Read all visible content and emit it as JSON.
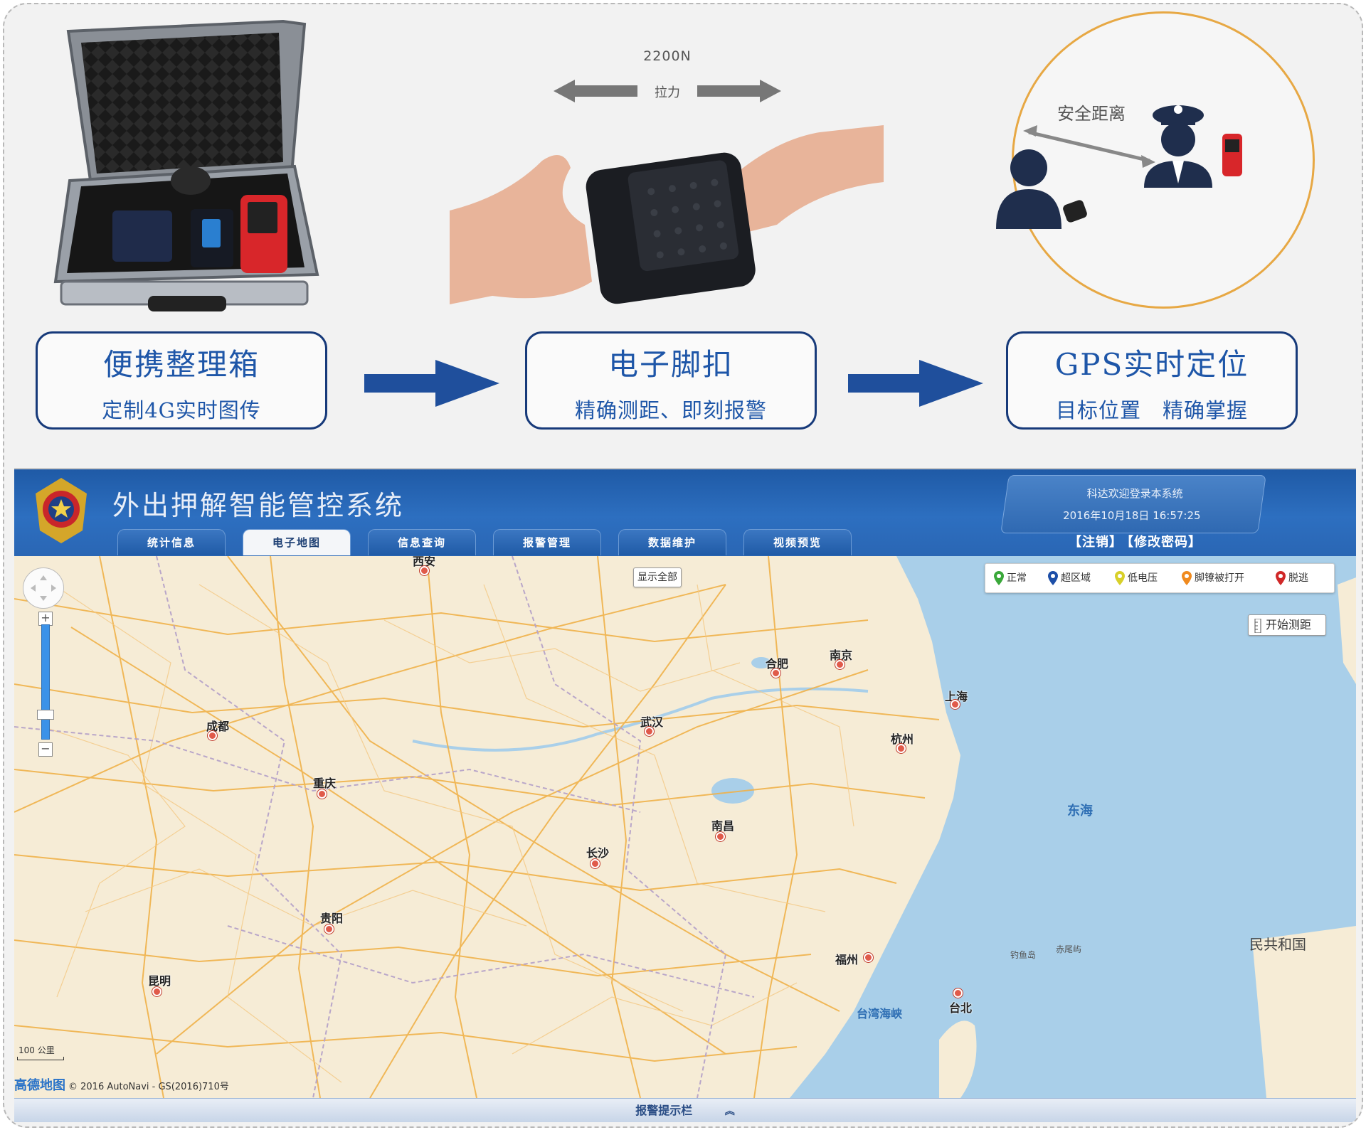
{
  "promo": {
    "force_value": "2200N",
    "force_label": "拉力",
    "safe_distance": "安全距离",
    "cards": [
      {
        "title": "便携整理箱",
        "subtitle": "定制4G实时图传"
      },
      {
        "title": "电子脚扣",
        "subtitle": "精确测距、即刻报警"
      },
      {
        "title": "GPS实时定位",
        "subtitle": "目标位置　精确掌握"
      }
    ]
  },
  "app": {
    "title": "外出押解智能管控系统",
    "welcome": "科达欢迎登录本系统",
    "datetime": "2016年10月18日 16:57:25",
    "logout_link": "【注销】",
    "change_password_link": "【修改密码】",
    "tabs": [
      {
        "label": "统计信息"
      },
      {
        "label": "电子地图"
      },
      {
        "label": "信息查询"
      },
      {
        "label": "报警管理"
      },
      {
        "label": "数据维护"
      },
      {
        "label": "视频预览"
      }
    ],
    "active_tab": "电子地图",
    "status_bar": "报警提示栏",
    "colors": {
      "header": "#2a66b4",
      "card_border": "#173a7a",
      "card_text": "#1e56a8",
      "arrow": "#1f4f9c",
      "gps_ring": "#e7a844"
    }
  },
  "map": {
    "show_all": "显示全部",
    "measure": "开始测距",
    "scale": "100 公里",
    "copyright_brand": "高德地图",
    "copyright": "© 2016 AutoNavi - GS(2016)710号",
    "legend": [
      {
        "label": "正常",
        "color": "#3aa83a"
      },
      {
        "label": "超区域",
        "color": "#1d4fa8"
      },
      {
        "label": "低电压",
        "color": "#d8d02a"
      },
      {
        "label": "脚镣被打开",
        "color": "#f08a1e"
      },
      {
        "label": "脱逃",
        "color": "#d02828"
      }
    ],
    "cities": [
      "西安",
      "合肥",
      "南京",
      "上海",
      "成都",
      "武汉",
      "杭州",
      "重庆",
      "南昌",
      "长沙",
      "贵阳",
      "福州",
      "昆明",
      "台北"
    ],
    "labels": {
      "east_sea": "东海",
      "strait": "台湾海峡",
      "diaoyu": "钓鱼岛",
      "chiwei": "赤尾屿",
      "korea": "民共和国"
    }
  }
}
